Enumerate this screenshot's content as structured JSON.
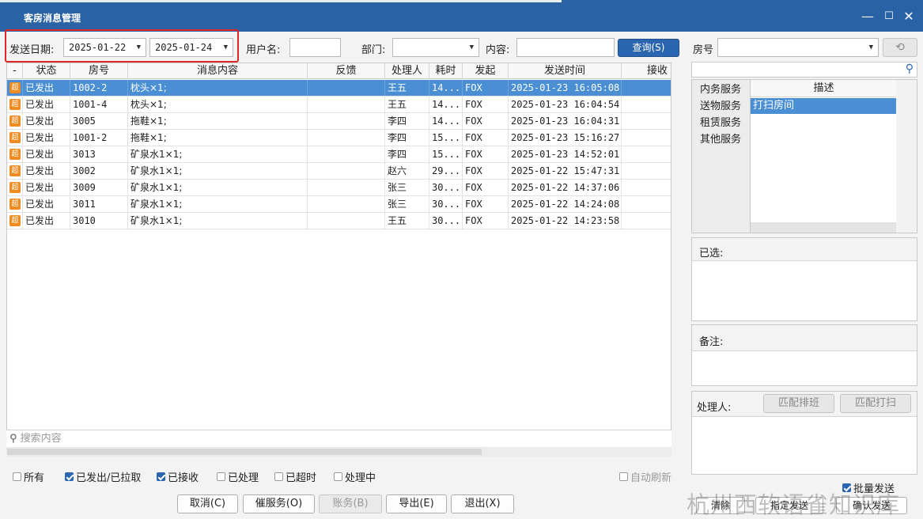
{
  "window": {
    "title": "客房消息管理",
    "controls": {
      "minimize": "—",
      "maximize": "☐",
      "close": "✕"
    }
  },
  "filters": {
    "date_label": "发送日期:",
    "date_from": "2025-01-22",
    "date_to": "2025-01-24",
    "user_label": "用户名:",
    "user_value": "",
    "dept_label": "部门:",
    "dept_value": "",
    "content_label": "内容:",
    "content_value": "",
    "query_button": "查询(S)"
  },
  "table": {
    "columns": [
      "-",
      "状态",
      "房号",
      "消息内容",
      "反馈",
      "处理人",
      "耗时",
      "发起",
      "发送时间",
      "接收"
    ],
    "rows": [
      {
        "badge": "超",
        "status": "已发出",
        "room": "1002-2",
        "content": "枕头×1;",
        "feedback": "",
        "handler": "王五",
        "duration": "14...",
        "initiator": "FOX",
        "time": "2025-01-23 16:05:08"
      },
      {
        "badge": "超",
        "status": "已发出",
        "room": "1001-4",
        "content": "枕头×1;",
        "feedback": "",
        "handler": "王五",
        "duration": "14...",
        "initiator": "FOX",
        "time": "2025-01-23 16:04:54"
      },
      {
        "badge": "超",
        "status": "已发出",
        "room": "3005",
        "content": "拖鞋×1;",
        "feedback": "",
        "handler": "李四",
        "duration": "14...",
        "initiator": "FOX",
        "time": "2025-01-23 16:04:31"
      },
      {
        "badge": "超",
        "status": "已发出",
        "room": "1001-2",
        "content": "拖鞋×1;",
        "feedback": "",
        "handler": "李四",
        "duration": "15...",
        "initiator": "FOX",
        "time": "2025-01-23 15:16:27"
      },
      {
        "badge": "超",
        "status": "已发出",
        "room": "3013",
        "content": "矿泉水1×1;",
        "feedback": "",
        "handler": "李四",
        "duration": "15...",
        "initiator": "FOX",
        "time": "2025-01-23 14:52:01"
      },
      {
        "badge": "超",
        "status": "已发出",
        "room": "3002",
        "content": "矿泉水1×1;",
        "feedback": "",
        "handler": "赵六",
        "duration": "29...",
        "initiator": "FOX",
        "time": "2025-01-22 15:47:31"
      },
      {
        "badge": "超",
        "status": "已发出",
        "room": "3009",
        "content": "矿泉水1×1;",
        "feedback": "",
        "handler": "张三",
        "duration": "30...",
        "initiator": "FOX",
        "time": "2025-01-22 14:37:06"
      },
      {
        "badge": "超",
        "status": "已发出",
        "room": "3011",
        "content": "矿泉水1×1;",
        "feedback": "",
        "handler": "张三",
        "duration": "30...",
        "initiator": "FOX",
        "time": "2025-01-22 14:24:08"
      },
      {
        "badge": "超",
        "status": "已发出",
        "room": "3010",
        "content": "矿泉水1×1;",
        "feedback": "",
        "handler": "王五",
        "duration": "30...",
        "initiator": "FOX",
        "time": "2025-01-22 14:23:58"
      }
    ],
    "selected_index": 0,
    "search_placeholder": "搜索内容"
  },
  "status_filters": [
    {
      "label": "所有",
      "checked": false
    },
    {
      "label": "已发出/已拉取",
      "checked": true
    },
    {
      "label": "已接收",
      "checked": true
    },
    {
      "label": "已处理",
      "checked": false
    },
    {
      "label": "已超时",
      "checked": false
    },
    {
      "label": "处理中",
      "checked": false
    }
  ],
  "auto_refresh": {
    "label": "自动刷新",
    "checked": false
  },
  "buttons": {
    "cancel": "取消(C)",
    "urge": "催服务(O)",
    "bill": "账务(B)",
    "export": "导出(E)",
    "exit": "退出(X)"
  },
  "right_panel": {
    "room_label": "房号",
    "room_value": "",
    "service_header": "描述",
    "categories": [
      "内务服务",
      "送物服务",
      "租赁服务",
      "其他服务"
    ],
    "descriptions": [
      "打扫房间"
    ],
    "selected_label": "已选:",
    "remark_label": "备注:",
    "handler_label": "处理人:",
    "match_schedule": "匹配排班",
    "match_clean": "匹配打扫",
    "batch_send": {
      "label": "批量发送",
      "checked": true
    },
    "clear": "清除",
    "assign_send": "指定发送",
    "confirm_send": "确认发送"
  },
  "watermark": "杭州西软语雀知识库",
  "colors": {
    "titlebar": "#2a62a6",
    "selected_row": "#4a8ed4",
    "accent": "#2a65b0",
    "badge": "#ef8c21",
    "highlight_box": "#e0272b"
  }
}
